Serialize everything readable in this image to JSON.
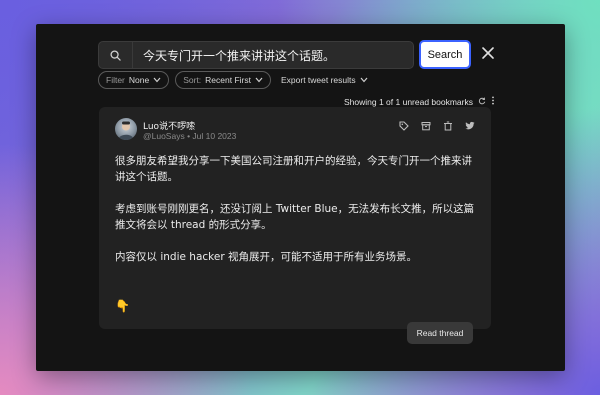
{
  "search": {
    "value": "今天专门开一个推来讲讲这个话题。",
    "button_label": "Search"
  },
  "filters": {
    "filter_label": "Filter",
    "filter_value": "None",
    "sort_label": "Sort:",
    "sort_value": "Recent First",
    "export_label": "Export tweet results"
  },
  "status": {
    "showing_text": "Showing 1 of 1 unread bookmarks"
  },
  "tweet": {
    "author_name": "Luo说不啰嗦",
    "author_meta": "@LuoSays • Jul 10 2023",
    "paragraphs": [
      "很多朋友希望我分享一下美国公司注册和开户的经验，今天专门开一个推来讲讲这个话题。",
      "考虑到账号刚刚更名，还没订阅上 Twitter Blue，无法发布长文推，所以这篇推文将会以 thread 的形式分享。",
      "内容仅以 indie hacker 视角展开，可能不适用于所有业务场景。"
    ],
    "emoji": "👇",
    "read_thread_label": "Read thread"
  },
  "colors": {
    "accent": "#3b62ff",
    "window_bg": "#141414",
    "card_bg": "#222222"
  }
}
